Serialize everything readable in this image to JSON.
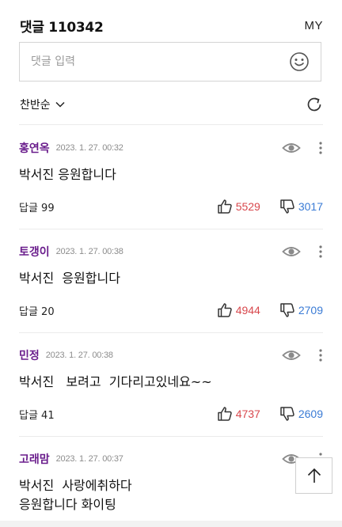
{
  "header": {
    "title": "댓글 110342",
    "my_label": "MY"
  },
  "input": {
    "placeholder": "댓글 입력"
  },
  "sort": {
    "label": "찬반순"
  },
  "comments": [
    {
      "nickname": "홍연옥",
      "date": "2023. 1. 27. 00:32",
      "text": "박서진 응원합니다",
      "reply": "답글 99",
      "up": "5529",
      "down": "3017"
    },
    {
      "nickname": "토갱이",
      "date": "2023. 1. 27. 00:38",
      "text": "박서진  응원합니다",
      "reply": "답글 20",
      "up": "4944",
      "down": "2709"
    },
    {
      "nickname": "민정",
      "date": "2023. 1. 27. 00:38",
      "text": "박서진   보려고  기다리고있네요~~",
      "reply": "답글 41",
      "up": "4737",
      "down": "2609"
    },
    {
      "nickname": "고래맘",
      "date": "2023. 1. 27. 00:37",
      "text": "박서진  사랑에취하다\n응원합니다 화이팅",
      "reply": "",
      "up": "",
      "down": ""
    }
  ],
  "colors": {
    "nickname": "#6a1d8c",
    "upvote": "#d8484d",
    "downvote": "#3a7bd5"
  },
  "icons": [
    "emoji-icon",
    "chevron-down-icon",
    "refresh-icon",
    "eye-icon",
    "more-vertical-icon",
    "thumbs-up-icon",
    "thumbs-down-icon",
    "arrow-up-icon"
  ]
}
